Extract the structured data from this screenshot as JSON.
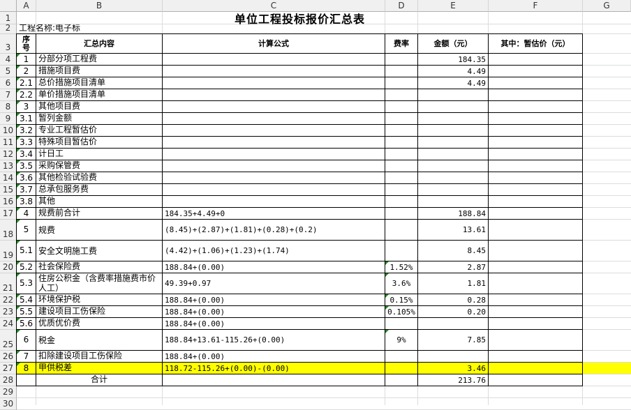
{
  "columns": [
    "A",
    "B",
    "C",
    "D",
    "E",
    "F",
    "G"
  ],
  "rows": [
    "1",
    "2",
    "3",
    "4",
    "5",
    "6",
    "7",
    "8",
    "9",
    "10",
    "11",
    "12",
    "13",
    "14",
    "15",
    "16",
    "17",
    "18",
    "19",
    "20",
    "21",
    "22",
    "23",
    "24",
    "25",
    "26",
    "27",
    "28",
    "29",
    "30"
  ],
  "sheet": {
    "title": "单位工程投标报价汇总表",
    "project_name": "工程名称:电子标",
    "headers": {
      "seq": "序号",
      "content": "汇总内容",
      "formula": "计算公式",
      "rate": "费率",
      "amount": "金额（元）",
      "provisional": "其中：暂估价（元）"
    },
    "items": [
      {
        "seq": "1",
        "content": "分部分项工程费",
        "formula": "",
        "rate": "",
        "amount": "184.35"
      },
      {
        "seq": "2",
        "content": "措施项目费",
        "formula": "",
        "rate": "",
        "amount": "4.49"
      },
      {
        "seq": "2.1",
        "content": "总价措施项目清单",
        "formula": "",
        "rate": "",
        "amount": "4.49"
      },
      {
        "seq": "2.2",
        "content": "单价措施项目清单",
        "formula": "",
        "rate": "",
        "amount": ""
      },
      {
        "seq": "3",
        "content": "其他项目费",
        "formula": "",
        "rate": "",
        "amount": ""
      },
      {
        "seq": "3.1",
        "content": "暂列金额",
        "formula": "",
        "rate": "",
        "amount": ""
      },
      {
        "seq": "3.2",
        "content": "专业工程暂估价",
        "formula": "",
        "rate": "",
        "amount": ""
      },
      {
        "seq": "3.3",
        "content": "特殊项目暂估价",
        "formula": "",
        "rate": "",
        "amount": ""
      },
      {
        "seq": "3.4",
        "content": "计日工",
        "formula": "",
        "rate": "",
        "amount": ""
      },
      {
        "seq": "3.5",
        "content": "采购保管费",
        "formula": "",
        "rate": "",
        "amount": ""
      },
      {
        "seq": "3.6",
        "content": "其他检验试验费",
        "formula": "",
        "rate": "",
        "amount": ""
      },
      {
        "seq": "3.7",
        "content": "总承包服务费",
        "formula": "",
        "rate": "",
        "amount": ""
      },
      {
        "seq": "3.8",
        "content": "其他",
        "formula": "",
        "rate": "",
        "amount": ""
      },
      {
        "seq": "4",
        "content": "规费前合计",
        "formula": "184.35+4.49+0",
        "rate": "",
        "amount": "188.84"
      },
      {
        "seq": "5",
        "content": "规费",
        "formula": "(8.45)+(2.87)+(1.81)+(0.28)+(0.2)",
        "rate": "",
        "amount": "13.61"
      },
      {
        "seq": "5.1",
        "content": "安全文明施工费",
        "formula": "(4.42)+(1.06)+(1.23)+(1.74)",
        "rate": "",
        "amount": "8.45"
      },
      {
        "seq": "5.2",
        "content": "社会保险费",
        "formula": "188.84+(0.00)",
        "rate": "1.52%",
        "amount": "2.87"
      },
      {
        "seq": "5.3",
        "content": "住房公积金（含费率措施费市价人工）",
        "formula": "49.39+0.97",
        "rate": "3.6%",
        "amount": "1.81"
      },
      {
        "seq": "5.4",
        "content": "环境保护税",
        "formula": "188.84+(0.00)",
        "rate": "0.15%",
        "amount": "0.28"
      },
      {
        "seq": "5.5",
        "content": "建设项目工伤保险",
        "formula": "188.84+(0.00)",
        "rate": "0.105%",
        "amount": "0.20"
      },
      {
        "seq": "5.6",
        "content": "优质优价费",
        "formula": "188.84+(0.00)",
        "rate": "",
        "amount": ""
      },
      {
        "seq": "6",
        "content": "税金",
        "formula": "188.84+13.61-115.26+(0.00)",
        "rate": "9%",
        "amount": "7.85"
      },
      {
        "seq": "7",
        "content": "扣除建设项目工伤保险",
        "formula": "188.84+(0.00)",
        "rate": "",
        "amount": ""
      },
      {
        "seq": "8",
        "content": "甲供税差",
        "formula": "118.72-115.26+(0.00)-(0.00)",
        "rate": "",
        "amount": "3.46"
      }
    ],
    "total_label": "合计",
    "total_amount": "213.76",
    "highlight_color": "#ffff00",
    "error_indicator_color": "#1f8a1f"
  }
}
